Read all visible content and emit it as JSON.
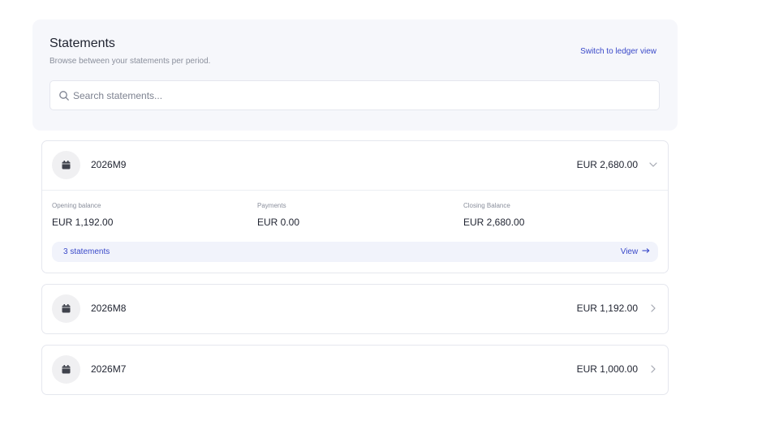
{
  "header": {
    "title": "Statements",
    "subtitle": "Browse between your statements per period.",
    "switch_link": "Switch to ledger view"
  },
  "search": {
    "placeholder": "Search statements...",
    "value": ""
  },
  "statements": [
    {
      "period": "2026M9",
      "amount": "EUR 2,680.00",
      "expanded": true,
      "opening_label": "Opening balance",
      "opening_value": "EUR 1,192.00",
      "payments_label": "Payments",
      "payments_value": "EUR 0.00",
      "closing_label": "Closing Balance",
      "closing_value": "EUR 2,680.00",
      "count_label": "3 statements",
      "view_label": "View"
    },
    {
      "period": "2026M8",
      "amount": "EUR 1,192.00",
      "expanded": false
    },
    {
      "period": "2026M7",
      "amount": "EUR 1,000.00",
      "expanded": false
    }
  ],
  "icons": {
    "search": "search-icon",
    "calendar": "calendar-icon",
    "chevron_down": "chevron-down-icon",
    "chevron_right": "chevron-right-icon",
    "arrow_right": "arrow-right-icon"
  },
  "colors": {
    "accent": "#3a49c9",
    "header_bg": "#f6f7fb",
    "pill_bg": "#f1f3fb"
  }
}
